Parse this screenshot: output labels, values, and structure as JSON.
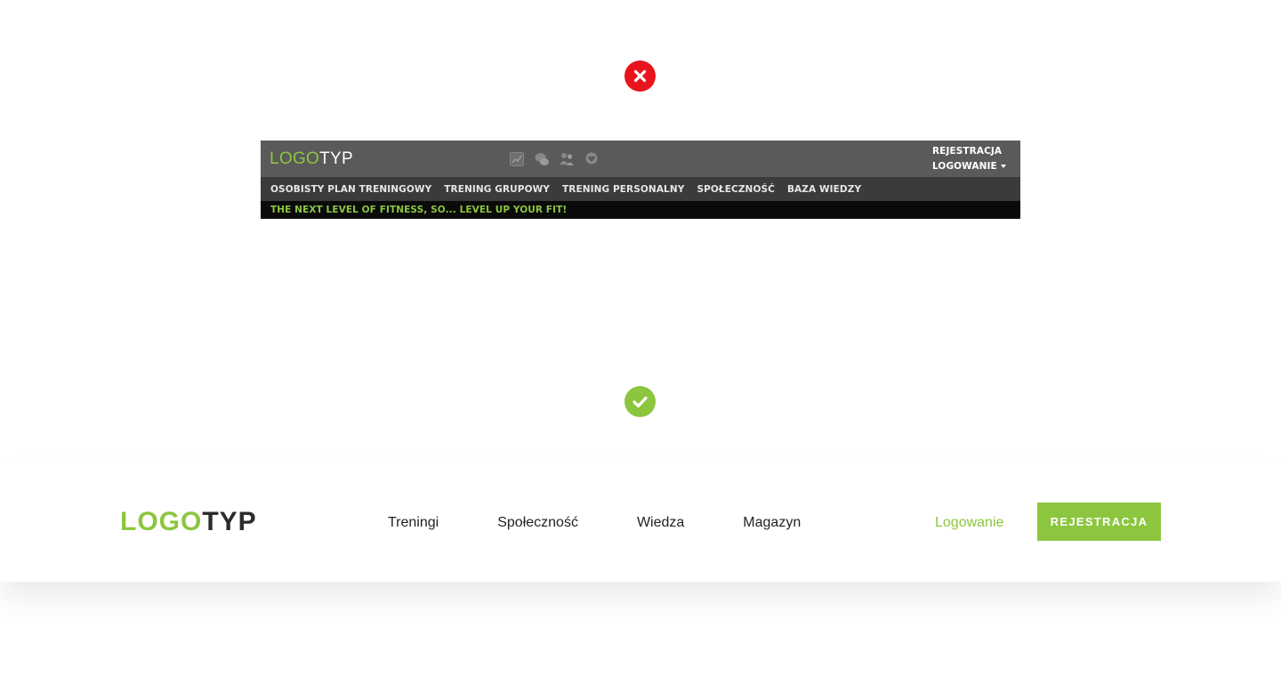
{
  "bad_mark": {
    "icon": "close-icon",
    "color": "#e8141c"
  },
  "good_mark": {
    "icon": "check-icon",
    "color": "#8cc63f"
  },
  "old_header": {
    "logo": {
      "part_green": "LOGO",
      "part_white": "TYP"
    },
    "icons": [
      "chart-icon",
      "chat-icon",
      "users-icon",
      "heart-icon"
    ],
    "auth": {
      "register": "REJESTRACJA",
      "login": "LOGOWANIE"
    },
    "nav": [
      {
        "label": "OSOBISTY PLAN TRENINGOWY"
      },
      {
        "label": "TRENING GRUPOWY"
      },
      {
        "label": "TRENING PERSONALNY"
      },
      {
        "label": "SPOŁECZNOŚĆ"
      },
      {
        "label": "BAZA WIEDZY"
      }
    ],
    "tagline": "THE NEXT LEVEL OF FITNESS, SO... LEVEL UP YOUR FIT!",
    "colors": {
      "top": "#5a5a5a",
      "nav": "#3b3b3b",
      "tagline_bg": "#0b0b0b",
      "accent": "#8cc63f"
    }
  },
  "new_header": {
    "logo": {
      "part_green": "LOGO",
      "part_dark": "TYP"
    },
    "nav": [
      {
        "label": "Treningi"
      },
      {
        "label": "Społeczność"
      },
      {
        "label": "Wiedza"
      },
      {
        "label": "Magazyn"
      }
    ],
    "login": "Logowanie",
    "register": "REJESTRACJA",
    "colors": {
      "accent": "#8cc63f",
      "text": "#222222"
    }
  }
}
